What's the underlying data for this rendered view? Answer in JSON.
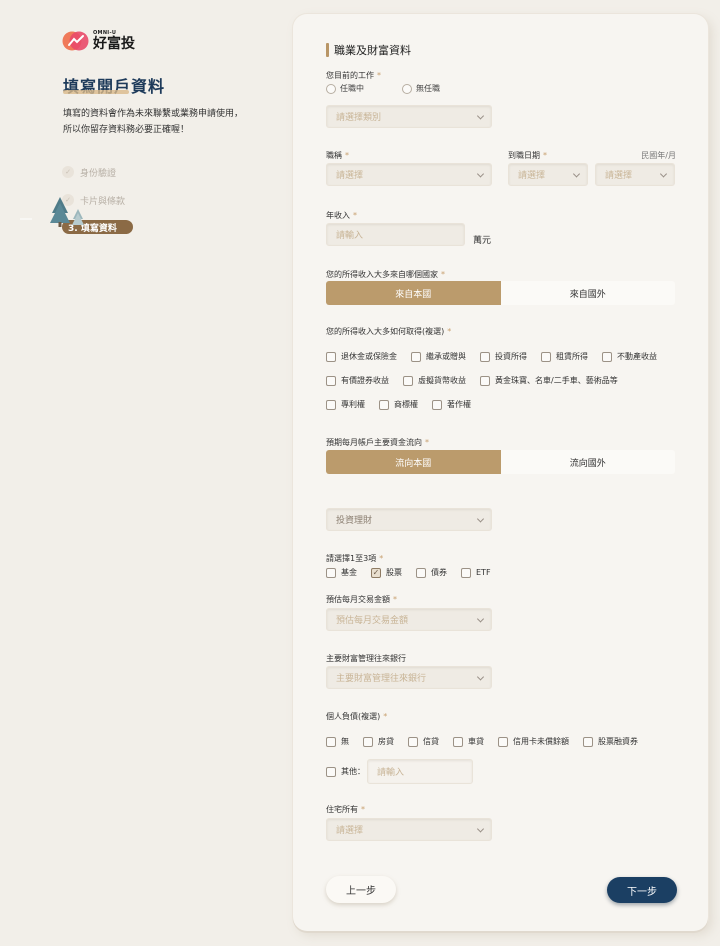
{
  "brand": {
    "en": "OMNI-U",
    "zh": "好富投"
  },
  "left": {
    "title": "填寫開戶資料",
    "intro": "填寫的資料會作為未來聯繫或業務申請使用，所以你留存資料務必要正確喔！",
    "steps": [
      {
        "label": "身份驗證",
        "state": "done"
      },
      {
        "label": "卡片與條款",
        "state": "done"
      },
      {
        "label": "3.  填寫資料",
        "state": "active"
      }
    ]
  },
  "form": {
    "section_title": "職業及財富資料",
    "job": {
      "label": "您目前的工作",
      "options": [
        "任職中",
        "無任職"
      ],
      "category_placeholder": "請選擇類別"
    },
    "position": {
      "label": "職稱",
      "placeholder": "請選擇"
    },
    "start_date": {
      "label": "到職日期",
      "hint": "民國年/月",
      "year_placeholder": "請選擇",
      "month_placeholder": "請選擇"
    },
    "income": {
      "label": "年收入",
      "placeholder": "請輸入",
      "unit": "萬元"
    },
    "income_country": {
      "label": "您的所得收入大多來自哪個國家",
      "options": [
        "來自本國",
        "來自國外"
      ]
    },
    "income_source": {
      "label": "您的所得收入大多如何取得(複選)",
      "row1": [
        "退休金或保險金",
        "繼承或贈與",
        "投資所得",
        "租賃所得",
        "不動產收益"
      ],
      "row2": [
        "有價證券收益",
        "虛擬貨幣收益",
        "黃金珠寶、名車/二手車、藝術品等"
      ],
      "row3": [
        "專利權",
        "商標權",
        "著作權"
      ]
    },
    "fund_flow": {
      "label": "預期每月帳戶主要資金流向",
      "options": [
        "流向本國",
        "流向國外"
      ]
    },
    "purpose": {
      "value": "投資理財"
    },
    "products": {
      "label": "請選擇1至3項",
      "options": [
        "基金",
        "股票",
        "債券",
        "ETF"
      ],
      "checked": "股票"
    },
    "monthly_amount": {
      "label": "預估每月交易金額",
      "placeholder": "預估每月交易金額"
    },
    "bank": {
      "label": "主要財富管理往來銀行",
      "placeholder": "主要財富管理往來銀行"
    },
    "debt": {
      "label": "個人負債(複選)",
      "options": [
        "無",
        "房貸",
        "信貸",
        "車貸",
        "信用卡未償餘額",
        "股票融資券"
      ],
      "other_label": "其他：",
      "other_placeholder": "請輸入"
    },
    "housing": {
      "label": "住宅所有",
      "placeholder": "請選擇"
    },
    "buttons": {
      "prev": "上一步",
      "next": "下一步"
    }
  },
  "colors": {
    "accent": "#bb9b6c",
    "primary": "#1b3f63",
    "title": "#1d3a5a"
  }
}
